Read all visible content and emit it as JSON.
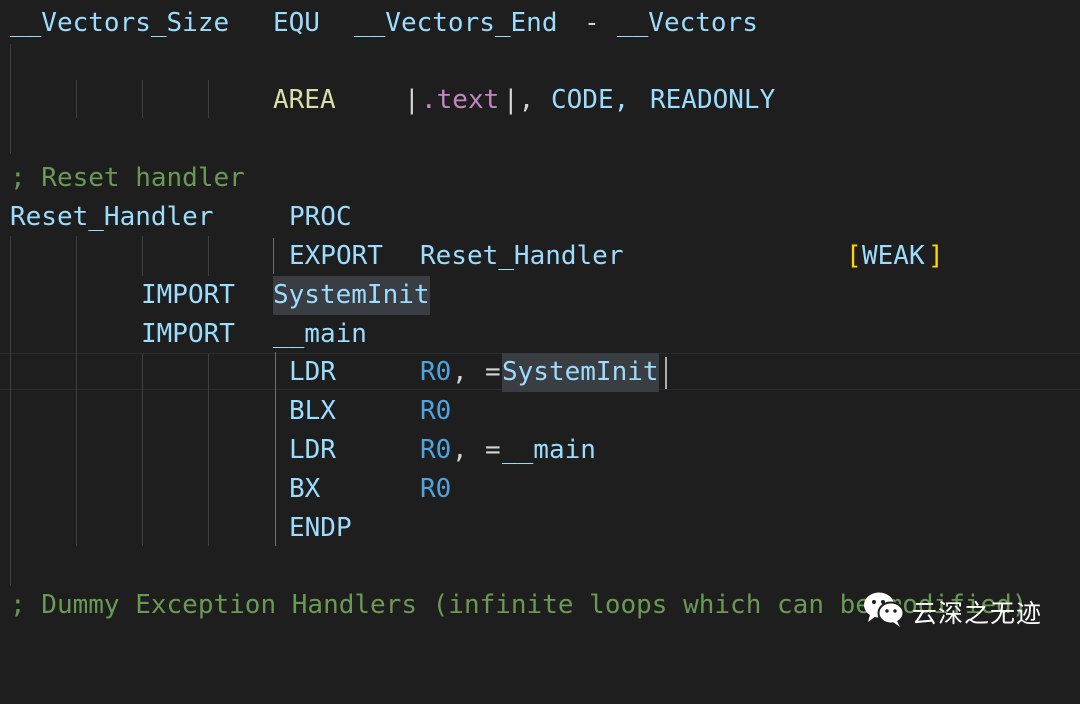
{
  "editor": {
    "lines": [
      {
        "tokens": [
          {
            "text": "__Vectors_Size",
            "color": "light"
          },
          {
            "text": "EQU",
            "color": "light"
          },
          {
            "text": "__Vectors_End",
            "color": "light"
          },
          {
            "text": "-",
            "color": "plain"
          },
          {
            "text": "__Vectors",
            "color": "light"
          }
        ]
      },
      {
        "tokens": [
          {
            "text": "AREA",
            "color": "yellow"
          },
          {
            "text": "|",
            "color": "plain"
          },
          {
            "text": ".text",
            "color": "pink"
          },
          {
            "text": "|,",
            "color": "plain"
          },
          {
            "text": "CODE,",
            "color": "light"
          },
          {
            "text": "READONLY",
            "color": "light"
          }
        ]
      },
      {
        "tokens": [
          {
            "text": "; Reset handler",
            "color": "comment"
          }
        ]
      },
      {
        "tokens": [
          {
            "text": "Reset_Handler",
            "color": "light"
          },
          {
            "text": "PROC",
            "color": "light"
          }
        ]
      },
      {
        "tokens": [
          {
            "text": "EXPORT",
            "color": "light"
          },
          {
            "text": "Reset_Handler",
            "color": "light"
          },
          {
            "text": "[",
            "color": "gold"
          },
          {
            "text": "WEAK",
            "color": "light"
          },
          {
            "text": "]",
            "color": "gold"
          }
        ]
      },
      {
        "tokens": [
          {
            "text": "IMPORT",
            "color": "light"
          },
          {
            "text": "SystemInit",
            "color": "light"
          }
        ]
      },
      {
        "tokens": [
          {
            "text": "IMPORT",
            "color": "light"
          },
          {
            "text": "__main",
            "color": "light"
          }
        ]
      },
      {
        "tokens": [
          {
            "text": "LDR",
            "color": "light"
          },
          {
            "text": "R0",
            "color": "blue"
          },
          {
            "text": ",",
            "color": "plain"
          },
          {
            "text": "=",
            "color": "plain"
          },
          {
            "text": "SystemInit",
            "color": "light"
          }
        ]
      },
      {
        "tokens": [
          {
            "text": "BLX",
            "color": "light"
          },
          {
            "text": "R0",
            "color": "blue"
          }
        ]
      },
      {
        "tokens": [
          {
            "text": "LDR",
            "color": "light"
          },
          {
            "text": "R0",
            "color": "blue"
          },
          {
            "text": ",",
            "color": "plain"
          },
          {
            "text": "=",
            "color": "plain"
          },
          {
            "text": "__main",
            "color": "light"
          }
        ]
      },
      {
        "tokens": [
          {
            "text": "BX",
            "color": "light"
          },
          {
            "text": "R0",
            "color": "blue"
          }
        ]
      },
      {
        "tokens": [
          {
            "text": "ENDP",
            "color": "light"
          }
        ]
      },
      {
        "tokens": [
          {
            "text": "; Dummy Exception Handlers (infinite loops which can be modified)",
            "color": "comment"
          }
        ]
      }
    ]
  },
  "colors": {
    "background": "#1e1e1e",
    "light": "#9cdcfe",
    "yellow": "#dcdcaa",
    "blue": "#4fa3e0",
    "comment": "#6a9955",
    "pink": "#c586c0",
    "gold": "#ffd700",
    "plain": "#d4d4d4",
    "selection_highlight": "#3a3d41"
  },
  "watermark": {
    "icon": "wechat-icon",
    "text": "云深之无迹"
  }
}
